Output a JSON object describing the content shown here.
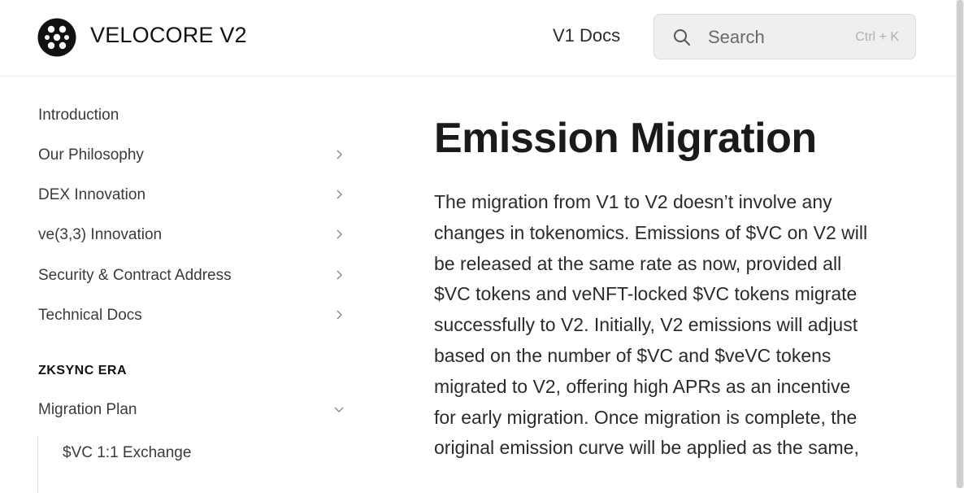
{
  "header": {
    "brand": "VELOCORE V2",
    "v1_docs_link": "V1 Docs",
    "search": {
      "placeholder": "Search",
      "shortcut": "Ctrl + K"
    }
  },
  "sidebar": {
    "items": [
      {
        "label": "Introduction",
        "has_chevron": false
      },
      {
        "label": "Our Philosophy",
        "has_chevron": true
      },
      {
        "label": "DEX Innovation",
        "has_chevron": true
      },
      {
        "label": "ve(3,3) Innovation",
        "has_chevron": true
      },
      {
        "label": "Security & Contract Address",
        "has_chevron": true
      },
      {
        "label": "Technical Docs",
        "has_chevron": true
      }
    ],
    "section_title": "ZKSYNC ERA",
    "section_items": [
      {
        "label": "Migration Plan",
        "expanded": true
      }
    ],
    "sub_items": [
      {
        "label": "$VC 1:1 Exchange"
      }
    ]
  },
  "main": {
    "title": "Emission Migration",
    "paragraph": "The migration from V1 to V2 doesn’t involve any changes in tokenomics. Emissions of $VC on V2 will be released at the same rate as now, provided all $VC tokens and veNFT-locked $VC tokens migrate successfully to V2. Initially, V2 emissions will adjust based on the number of $VC and $veVC tokens migrated to V2, offering high APRs as an incentive for early migration. Once migration is complete, the original emission curve will be applied as the same,"
  }
}
